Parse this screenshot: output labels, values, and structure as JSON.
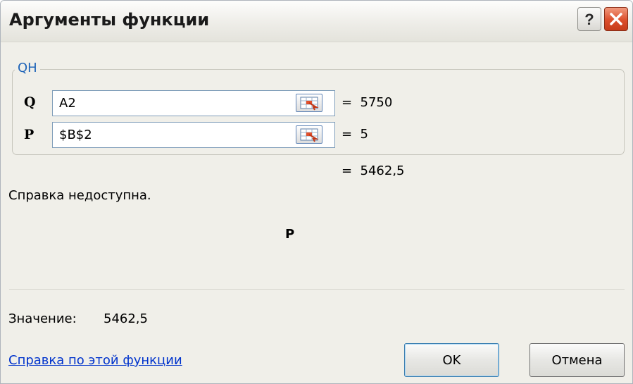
{
  "dialog": {
    "title": "Аргументы функции",
    "help_icon": "question-mark-icon",
    "close_icon": "close-x-icon"
  },
  "function_group": {
    "name": "QH",
    "args": [
      {
        "label": "Q",
        "value": "A2",
        "result": "=  5750"
      },
      {
        "label": "P",
        "value": "$B$2",
        "result": "=  5"
      }
    ],
    "ref_icon": "range-select-icon"
  },
  "formula_result": "=  5462,5",
  "help_unavailable": "Справка недоступна.",
  "arg_description_name": "P",
  "value_label": "Значение:",
  "value": "5462,5",
  "help_link": "Справка по этой функции",
  "buttons": {
    "ok": "OK",
    "cancel": "Отмена"
  },
  "colors": {
    "group_label": "#1f64b8",
    "link": "#0033cc",
    "close_button": "#dc4e2b"
  }
}
